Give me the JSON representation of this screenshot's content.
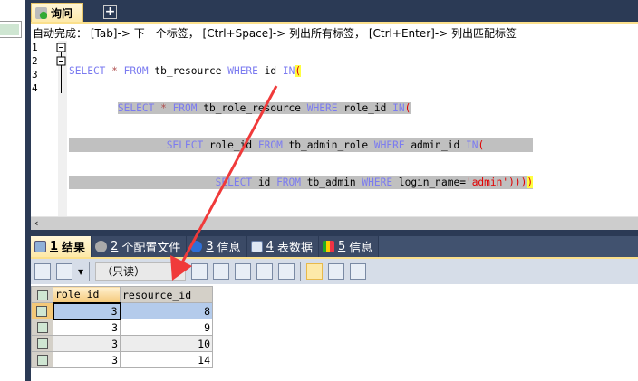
{
  "query_tab": {
    "label": "询问"
  },
  "add_tab": "+",
  "hint": "自动完成： [Tab]-> 下一个标签， [Ctrl+Space]-> 列出所有标签， [Ctrl+Enter]-> 列出匹配标签",
  "line_numbers": [
    "1",
    "2",
    "3",
    "4"
  ],
  "code_lines": [
    "SELECT * FROM tb_resource WHERE id IN(",
    "        SELECT * FROM tb_role_resource WHERE role_id IN(",
    "                SELECT role_id FROM tb_admin_role WHERE admin_id IN(",
    "                        SELECT id FROM tb_admin WHERE login_name='admin'))))"
  ],
  "scroll_left": "‹",
  "result_tabs": [
    {
      "num": "1",
      "label": "结果"
    },
    {
      "num": "2",
      "label": "个配置文件"
    },
    {
      "num": "3",
      "label": "信息"
    },
    {
      "num": "4",
      "label": "表数据"
    },
    {
      "num": "5",
      "label": "信息"
    }
  ],
  "toolbar": {
    "mode_select": "（只读）",
    "dropdown": "⌵"
  },
  "grid": {
    "columns": [
      "role_id",
      "resource_id"
    ],
    "rows": [
      [
        "3",
        "8"
      ],
      [
        "3",
        "9"
      ],
      [
        "3",
        "10"
      ],
      [
        "3",
        "14"
      ]
    ]
  },
  "annotation_color": "#f03a3a"
}
